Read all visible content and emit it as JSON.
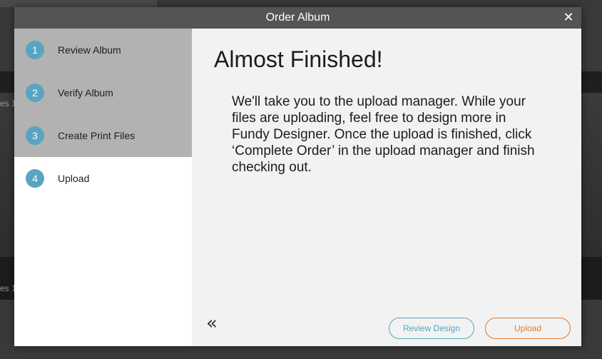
{
  "window": {
    "title": "Order Album",
    "close_glyph": "✕"
  },
  "background": {
    "label_1": "es 1",
    "label_2": "es 1"
  },
  "sidebar": {
    "steps": [
      {
        "number": "1",
        "label": "Review Album",
        "active": false
      },
      {
        "number": "2",
        "label": "Verify Album",
        "active": false
      },
      {
        "number": "3",
        "label": "Create Print Files",
        "active": false
      },
      {
        "number": "4",
        "label": "Upload",
        "active": true
      }
    ]
  },
  "main": {
    "heading": "Almost Finished!",
    "body": "We'll take you to the upload manager. While your files are uploading, feel free to design more in Fundy Designer. Once the upload is finished, click ‘Complete Order’ in the upload manager and finish checking out.",
    "back_glyph": "«",
    "review_design_label": "Review Design",
    "upload_label": "Upload"
  },
  "colors": {
    "accent_blue": "#5aa4c1",
    "accent_orange": "#e07a2c",
    "titlebar": "#545454",
    "sidebar_inactive": "#b2b2b2"
  }
}
